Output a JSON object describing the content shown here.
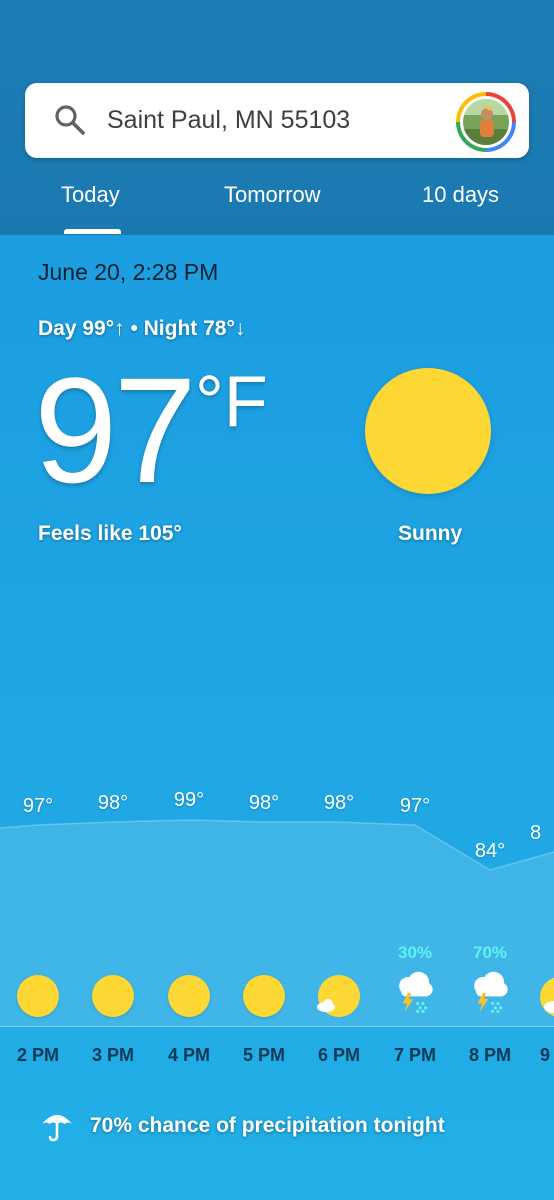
{
  "search": {
    "location": "Saint Paul, MN 55103"
  },
  "tabs": [
    {
      "label": "Today",
      "selected": true
    },
    {
      "label": "Tomorrow",
      "selected": false
    },
    {
      "label": "10 days",
      "selected": false
    }
  ],
  "current": {
    "date_time": "June 20, 2:28 PM",
    "day_night": "Day 99°↑ • Night 78°↓",
    "temperature": "97",
    "unit": "°F",
    "feels_like": "Feels like 105°",
    "condition": "Sunny",
    "condition_icon": "sun-icon"
  },
  "hourly": [
    {
      "time": "2 PM",
      "temp": "97°",
      "precip": "",
      "icon": "sun-icon"
    },
    {
      "time": "3 PM",
      "temp": "98°",
      "precip": "",
      "icon": "sun-icon"
    },
    {
      "time": "4 PM",
      "temp": "99°",
      "precip": "",
      "icon": "sun-icon"
    },
    {
      "time": "5 PM",
      "temp": "98°",
      "precip": "",
      "icon": "sun-icon"
    },
    {
      "time": "6 PM",
      "temp": "98°",
      "precip": "",
      "icon": "sun-cloud-icon"
    },
    {
      "time": "7 PM",
      "temp": "97°",
      "precip": "30%",
      "icon": "thunderstorm-icon"
    },
    {
      "time": "8 PM",
      "temp": "84°",
      "precip": "70%",
      "icon": "thunderstorm-icon"
    },
    {
      "time": "9",
      "temp": "8",
      "precip": "",
      "icon": "sun-cloud-icon"
    }
  ],
  "precipitation_summary": "70% chance of precipitation tonight",
  "colors": {
    "header": "#1c7db5",
    "sky": "#1fa6e3",
    "sun": "#fdd835",
    "precip": "#5ff2f2"
  }
}
